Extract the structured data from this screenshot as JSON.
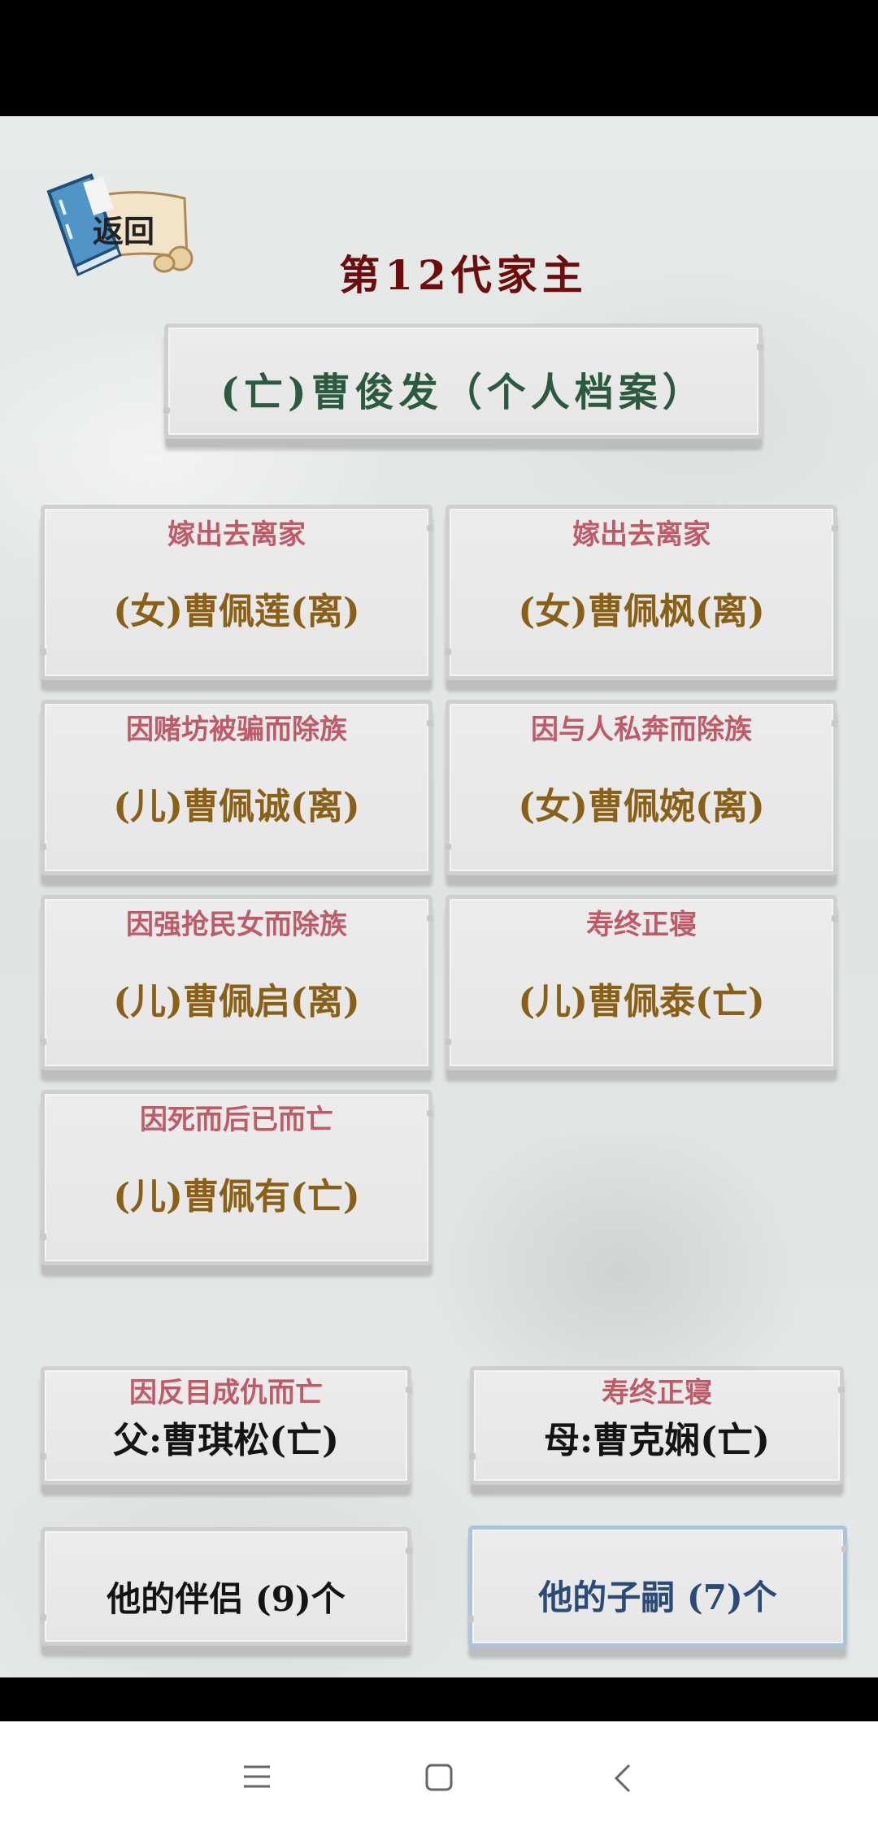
{
  "header": {
    "back_label": "返回",
    "generation_title": "第12代家主",
    "profile_title": "(亡)曹俊发（个人档案）"
  },
  "children": [
    {
      "status": "嫁出去离家",
      "name": "(女)曹佩莲(离)"
    },
    {
      "status": "嫁出去离家",
      "name": "(女)曹佩枫(离)"
    },
    {
      "status": "因赌坊被骗而除族",
      "name": "(儿)曹佩诚(离)"
    },
    {
      "status": "因与人私奔而除族",
      "name": "(女)曹佩婉(离)"
    },
    {
      "status": "因强抢民女而除族",
      "name": "(儿)曹佩启(离)"
    },
    {
      "status": "寿终正寝",
      "name": "(儿)曹佩泰(亡)"
    },
    {
      "status": "因死而后已而亡",
      "name": "(儿)曹佩有(亡)"
    }
  ],
  "parents": {
    "father": {
      "status": "因反目成仇而亡",
      "name": "父:曹琪松(亡)"
    },
    "mother": {
      "status": "寿终正寝",
      "name": "母:曹克娴(亡)"
    }
  },
  "buttons": {
    "partners_label": "他的伴侣 (9)个",
    "children_label": "他的子嗣 (7)个"
  },
  "colors": {
    "generation_title": "#6e0c0c",
    "profile_title": "#2c5a3e",
    "status_text": "#c05a66",
    "child_name": "#8a6016",
    "selected_button_text": "#2a4a78",
    "selected_button_border": "#a9c4dc"
  },
  "navigation_bar": {
    "icons": [
      "menu-icon",
      "home-icon",
      "back-arrow-icon"
    ]
  }
}
